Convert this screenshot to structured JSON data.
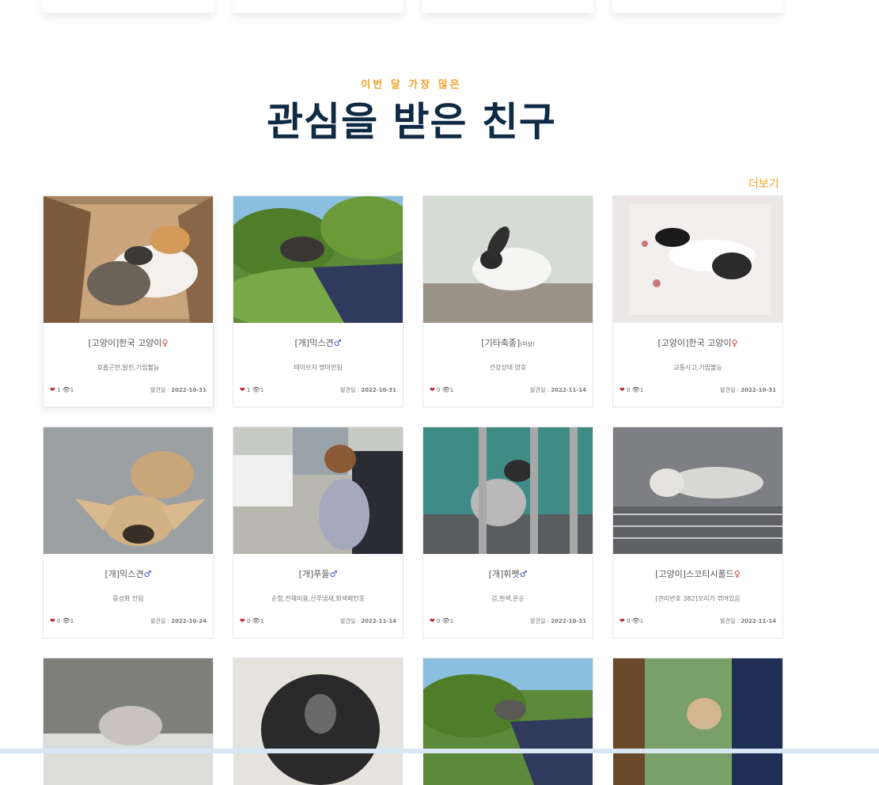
{
  "section": {
    "eyebrow": "이번 달 가장 많은",
    "title": "관심을 받은 친구",
    "more": "더보기"
  },
  "cards": [
    {
      "title": "[고양이]한국 고양이",
      "sym": "♀",
      "desc": "호흡곤란,탈진,기립불능",
      "likes": "1",
      "views": "1",
      "date_label": "발견일 :",
      "date": "2022-10-31",
      "photo": "cat-box"
    },
    {
      "title": "[개]믹스견",
      "sym": "♂",
      "desc": "테이브지 명마안됨",
      "likes": "1",
      "views": "1",
      "date_label": "발견일 :",
      "date": "2022-10-31",
      "photo": "dog-hand-tree"
    },
    {
      "title": "[기타축종]",
      "title_small": "(미상)",
      "sym": "",
      "desc": "건강상태 양호",
      "likes": "0",
      "views": "1",
      "date_label": "발견일 :",
      "date": "2022-11-14",
      "photo": "rabbit"
    },
    {
      "title": "[고양이]한국 고양이",
      "sym": "♀",
      "desc": "교통사고,기립불능",
      "likes": "0",
      "views": "1",
      "date_label": "발견일 :",
      "date": "2022-10-31",
      "photo": "cat-white"
    },
    {
      "title": "[개]믹스견",
      "sym": "♂",
      "desc": "중성화 안됨",
      "likes": "0",
      "views": "1",
      "date_label": "발견일 :",
      "date": "2022-10-24",
      "photo": "chihuahua"
    },
    {
      "title": "[개]푸들",
      "sym": "♂",
      "desc": "순함,전체미용,산푸냄새,회색패턴옷",
      "likes": "0",
      "views": "1",
      "date_label": "발견일 :",
      "date": "2022-11-14",
      "photo": "dog-held"
    },
    {
      "title": "[개]휘펫",
      "sym": "♂",
      "desc": "검,흰색,온순",
      "likes": "0",
      "views": "1",
      "date_label": "발견일 :",
      "date": "2022-10-31",
      "photo": "whippet"
    },
    {
      "title": "[고양이]스코티시폴드",
      "sym": "♀",
      "desc": "[관리번호 382]꼬리가 꺾여있음",
      "likes": "0",
      "views": "1",
      "date_label": "발견일 :",
      "date": "2022-11-14",
      "photo": "scottish-fold"
    },
    {
      "photo": "kitten-gray"
    },
    {
      "photo": "puppy-black"
    },
    {
      "photo": "dog-hand-tree2"
    },
    {
      "photo": "dog-cage"
    }
  ]
}
